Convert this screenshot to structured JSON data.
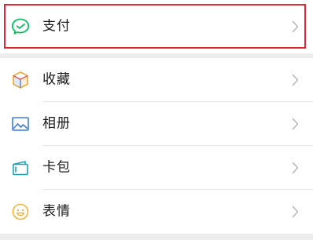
{
  "pay_section": {
    "item": {
      "label": "支付",
      "icon": "wechat-pay-icon",
      "color": "#07c160"
    }
  },
  "main_section": {
    "items": [
      {
        "label": "收藏",
        "icon": "favorites-cube-icon"
      },
      {
        "label": "相册",
        "icon": "album-picture-icon"
      },
      {
        "label": "卡包",
        "icon": "card-wallet-icon"
      },
      {
        "label": "表情",
        "icon": "sticker-smiley-icon"
      }
    ]
  },
  "colors": {
    "highlight": "#e0262e",
    "background": "#ededed",
    "row_background": "#ffffff",
    "chevron": "#b2b2b2"
  }
}
